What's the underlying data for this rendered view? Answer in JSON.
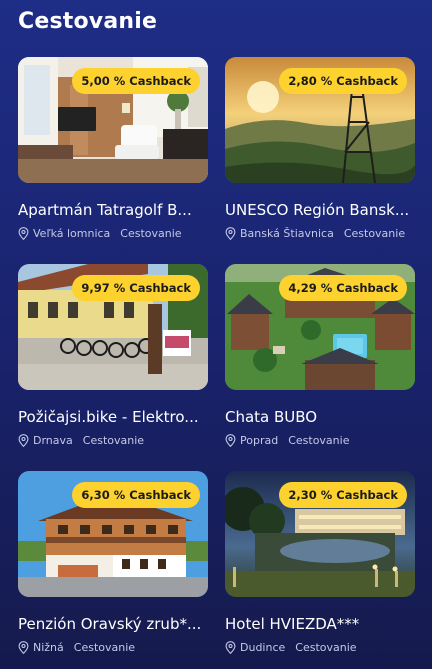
{
  "section": {
    "title": "Cestovanie"
  },
  "cards": [
    {
      "cashback": "5,00 % Cashback",
      "title": "Apartmán Tatragolf B...",
      "location": "Veľká lomnica",
      "category": "Cestovanie"
    },
    {
      "cashback": "2,80 % Cashback",
      "title": "UNESCO Región Bansk...",
      "location": "Banská Štiavnica",
      "category": "Cestovanie"
    },
    {
      "cashback": "9,97 % Cashback",
      "title": "Požičajsi.bike - Elektro...",
      "location": "Drnava",
      "category": "Cestovanie"
    },
    {
      "cashback": "4,29 % Cashback",
      "title": "Chata BUBO",
      "location": "Poprad",
      "category": "Cestovanie"
    },
    {
      "cashback": "6,30 % Cashback",
      "title": "Penzión Oravský zrub*...",
      "location": "Nižná",
      "category": "Cestovanie"
    },
    {
      "cashback": "2,30 % Cashback",
      "title": "Hotel HVIEZDA***",
      "location": "Dudince",
      "category": "Cestovanie"
    }
  ],
  "icons": {
    "location": "map-pin-icon"
  },
  "colors": {
    "badge": "#fdd22e",
    "background": "#1e2d86",
    "meta_text": "#c5c9e6"
  }
}
